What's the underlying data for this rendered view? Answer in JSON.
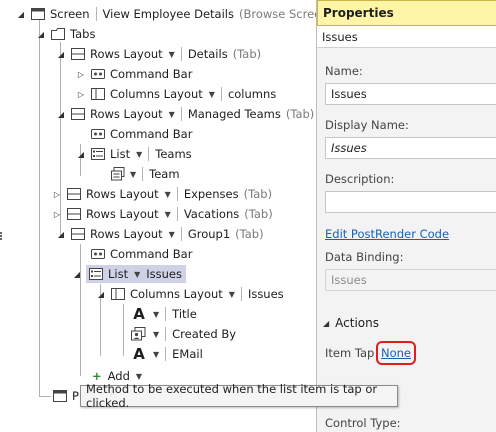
{
  "tree": {
    "screen": {
      "label": "Screen",
      "title": "View Employee Details",
      "hint": "(Browse Screen)"
    },
    "tabs_label": "Tabs",
    "details": {
      "label": "Rows Layout",
      "name": "Details",
      "hint": "(Tab)"
    },
    "details_command_bar": "Command Bar",
    "details_columns": {
      "label": "Columns Layout",
      "name": "columns"
    },
    "managed": {
      "label": "Rows Layout",
      "name": "Managed Teams",
      "hint": "(Tab)"
    },
    "managed_command_bar": "Command Bar",
    "teams_list": {
      "label": "List",
      "name": "Teams"
    },
    "team_item": "Team",
    "expenses": {
      "label": "Rows Layout",
      "name": "Expenses",
      "hint": "(Tab)"
    },
    "vacations": {
      "label": "Rows Layout",
      "name": "Vacations",
      "hint": "(Tab)"
    },
    "group1": {
      "label": "Rows Layout",
      "name": "Group1",
      "hint": "(Tab)"
    },
    "group1_command_bar": "Command Bar",
    "issues_list": {
      "label": "List",
      "name": "Issues"
    },
    "issues_columns": {
      "label": "Columns Layout",
      "name": "Issues"
    },
    "fields": [
      "Title",
      "Created By",
      "EMail"
    ],
    "add_label": "Add",
    "partial_p": "P"
  },
  "tooltip": "Method to be executed when the list item is tap or clicked.",
  "properties": {
    "title": "Properties",
    "selected": "Issues",
    "name_label": "Name:",
    "name_value": "Issues",
    "display_name_label": "Display Name:",
    "display_name_value": "Issues",
    "description_label": "Description:",
    "description_value": "",
    "edit_link": "Edit PostRender Code",
    "data_binding_label": "Data Binding:",
    "data_binding_value": "Issues",
    "actions_label": "Actions",
    "item_tap_label": "Item Tap",
    "item_tap_value": "None",
    "control_type_label": "Control Type:"
  },
  "colors": {
    "header_bg": "#fff5a6",
    "highlight": "#e11d1d",
    "link": "#1a5fb4",
    "selection": "#cfd2e6"
  },
  "icons": [
    "screen-icon",
    "tabs-folder-icon",
    "rows-layout-icon",
    "command-bar-icon",
    "columns-layout-icon",
    "list-icon",
    "item-icon",
    "text-icon",
    "dropdown-icon",
    "add-icon"
  ]
}
